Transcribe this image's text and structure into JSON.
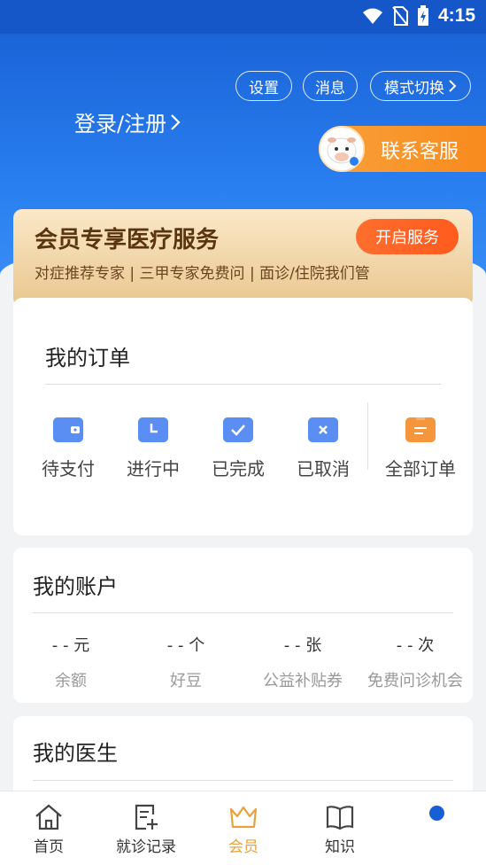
{
  "status_bar": {
    "time": "4:15"
  },
  "header": {
    "settings": "设置",
    "messages": "消息",
    "mode_switch": "模式切换",
    "login": "登录/注册",
    "customer_service": "联系客服"
  },
  "vip": {
    "title": "会员专享医疗服务",
    "subtitle": "对症推荐专家 |  三甲专家免费问 |   面诊/住院我们管",
    "button": "开启服务"
  },
  "orders": {
    "title": "我的订单",
    "items": [
      {
        "label": "待支付",
        "icon": "wallet-icon",
        "color": "#5a8ef2"
      },
      {
        "label": "进行中",
        "icon": "clock-icon",
        "color": "#5a8ef2"
      },
      {
        "label": "已完成",
        "icon": "check-icon",
        "color": "#5a8ef2"
      },
      {
        "label": "已取消",
        "icon": "cancel-icon",
        "color": "#5a8ef2"
      },
      {
        "label": "全部订单",
        "icon": "clipboard-icon",
        "color": "#f5953c"
      }
    ]
  },
  "account": {
    "title": "我的账户",
    "items": [
      {
        "value": "- - 元",
        "label": "余额"
      },
      {
        "value": "- - 个",
        "label": "好豆"
      },
      {
        "value": "- - 张",
        "label": "公益补贴券"
      },
      {
        "value": "- - 次",
        "label": "免费问诊机会"
      }
    ]
  },
  "doctor": {
    "title": "我的医生"
  },
  "nav": {
    "items": [
      {
        "label": "首页",
        "icon": "home-icon"
      },
      {
        "label": "就诊记录",
        "icon": "record-icon"
      },
      {
        "label": "会员",
        "icon": "crown-icon"
      },
      {
        "label": "知识",
        "icon": "book-icon"
      }
    ],
    "active_color": "#e8a23a"
  }
}
